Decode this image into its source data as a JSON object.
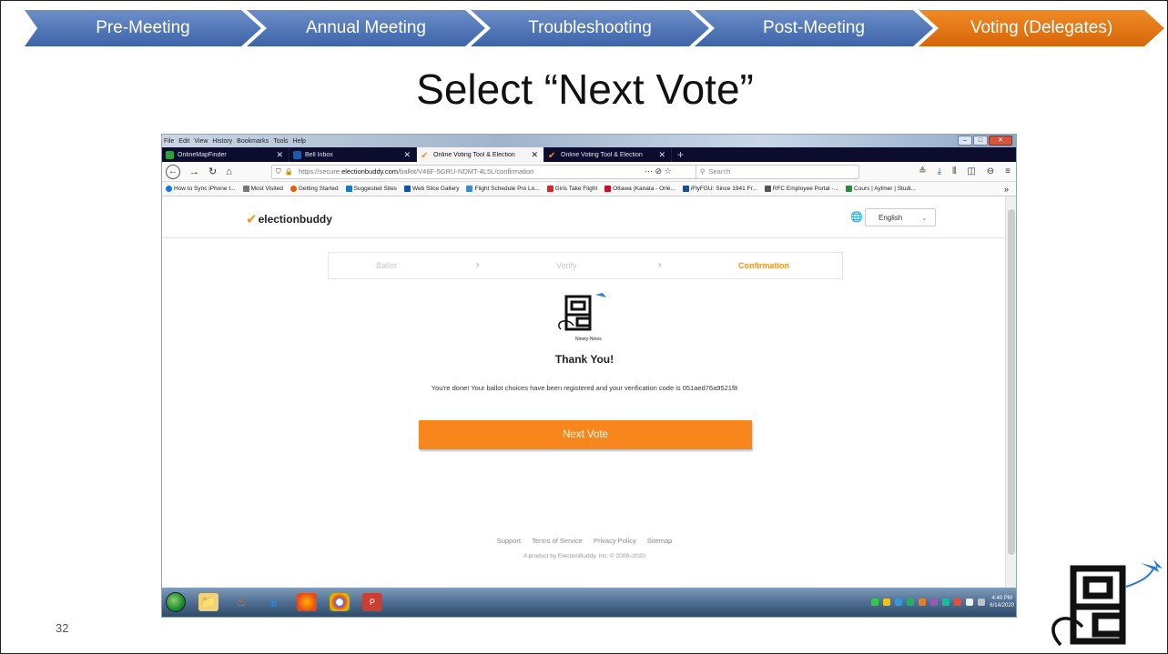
{
  "nav": {
    "chevrons": [
      {
        "label": "Pre-Meeting"
      },
      {
        "label": "Annual Meeting"
      },
      {
        "label": "Troubleshooting"
      },
      {
        "label": "Post-Meeting"
      },
      {
        "label": "Voting (Delegates)"
      }
    ],
    "active_color": "#e0700f",
    "inactive_color": "#4a70b3"
  },
  "slide": {
    "title": "Select “Next Vote”",
    "number": "32"
  },
  "browser": {
    "menu": [
      "File",
      "Edit",
      "View",
      "History",
      "Bookmarks",
      "Tools",
      "Help"
    ],
    "tabs": [
      {
        "label": "OnlineMapFinder",
        "icon": "map-favicon",
        "color": "#2e9e3e"
      },
      {
        "label": "Bell Inbox",
        "icon": "bell-favicon",
        "color": "#1d5aa8"
      },
      {
        "label": "Online Voting Tool & Election",
        "icon": "electionbuddy-favicon",
        "color": "#f7941d"
      },
      {
        "label": "Online Voting Tool & Election",
        "icon": "electionbuddy-favicon",
        "color": "#f7941d"
      }
    ],
    "url_prefix": "https://secure.",
    "url_domain": "electionbuddy.com",
    "url_path": "/ballot/V46F-5GRU-NDMT-4L5L/confirmation",
    "search_placeholder": "Search",
    "bookmarks": [
      {
        "label": "How to Sync iPhone t...",
        "color": "#1a73e8"
      },
      {
        "label": "Most Visited",
        "color": "#777777"
      },
      {
        "label": "Getting Started",
        "color": "#e66000"
      },
      {
        "label": "Suggested Sites",
        "color": "#1d7ac8"
      },
      {
        "label": "Web Slice Gallery",
        "color": "#1d4fa8"
      },
      {
        "label": "Flight Schedule Pro Lo...",
        "color": "#3a8ad8"
      },
      {
        "label": "Girls Take Flight",
        "color": "#d62828"
      },
      {
        "label": "Ottawa (Kanata - Orlé...",
        "color": "#c8102e"
      },
      {
        "label": "iFlyFGU: Since 1941 Fr...",
        "color": "#1f4e8c"
      },
      {
        "label": "RFC Employee Portal -...",
        "color": "#555555"
      },
      {
        "label": "Cours | Aylmer | Studi...",
        "color": "#2b8a3e"
      }
    ]
  },
  "app": {
    "brand": "electionbuddy",
    "language": "English",
    "steps": [
      "Ballot",
      "Verify",
      "Confirmation"
    ],
    "active_step": "Confirmation",
    "org_name": "Ninety-Nines",
    "thanks": "Thank You!",
    "done_message": "You're done! Your ballot choices have been registered and your verification code is 051aed76a9521f8",
    "next_button": "Next Vote",
    "footer_links": [
      "Support",
      "Terms of Service",
      "Privacy Policy",
      "Sitemap"
    ],
    "copyright": "A product by ElectionBuddy, Inc. © 2008–2020",
    "accent_color": "#f7861d"
  },
  "taskbar": {
    "time": "4:40 PM",
    "date": "6/14/2020"
  }
}
